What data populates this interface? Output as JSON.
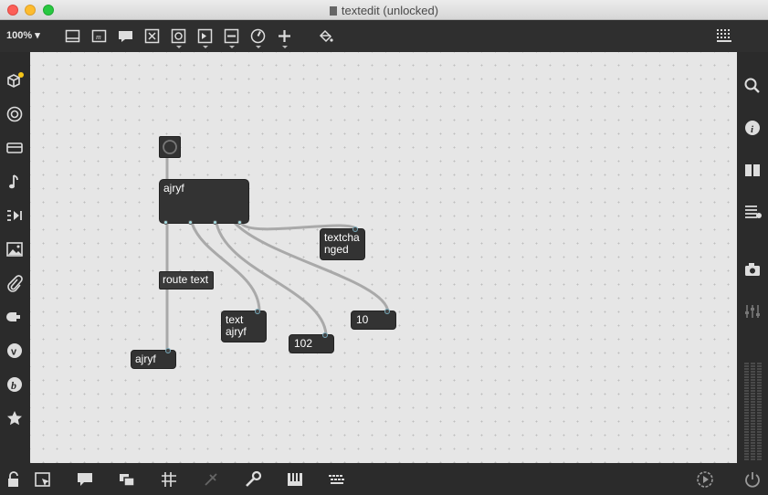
{
  "window": {
    "title": "textedit (unlocked)"
  },
  "toolbar": {
    "zoom": "100%"
  },
  "patch": {
    "textedit_label": "ajryf",
    "route_label": "route text",
    "textchanged_label": "textcha\nnged",
    "text_ajryf_label": "text\najryf",
    "num102_label": "102",
    "num10_label": "10",
    "out_ajryf_label": "ajryf"
  },
  "colors": {
    "canvas": "#e6e6e6",
    "object_bg": "#333333",
    "patch_cord": "#a9a9a9",
    "chrome": "#2b2b2b"
  }
}
